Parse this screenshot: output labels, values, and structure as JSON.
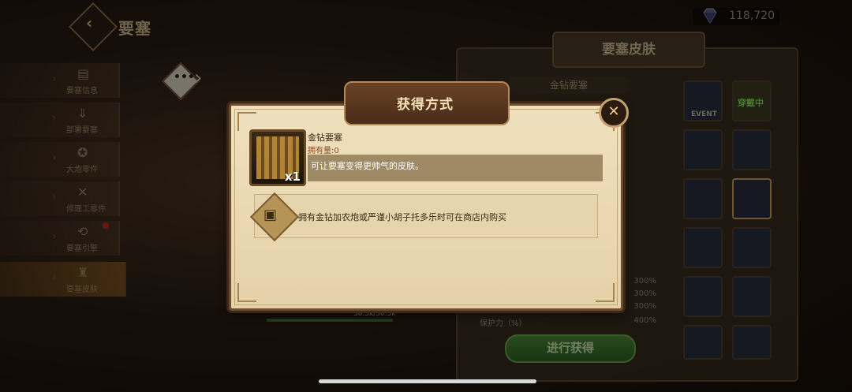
{
  "header": {
    "title": "要塞",
    "back_icon": "back-arrow-icon"
  },
  "currency": {
    "amount": "118,720",
    "icon": "gem-icon"
  },
  "sidebar": {
    "items": [
      {
        "label": "要塞信息",
        "icon": "book-icon"
      },
      {
        "label": "部署要塞",
        "icon": "deploy-icon"
      },
      {
        "label": "大炮零件",
        "icon": "cannon-part-icon"
      },
      {
        "label": "修理工零件",
        "icon": "repair-part-icon"
      },
      {
        "label": "要塞引擎",
        "icon": "engine-icon"
      },
      {
        "label": "要塞皮肤",
        "icon": "skin-icon"
      }
    ],
    "active_index": 5
  },
  "skin_panel": {
    "title": "要塞皮肤",
    "selected_name": "金钻要塞",
    "stats": [
      {
        "label": "",
        "value": "300%"
      },
      {
        "label": "",
        "value": "300%"
      },
      {
        "label": "",
        "value": "300%"
      },
      {
        "label": "保护力（%）",
        "value": "400%"
      }
    ],
    "acquire_button": "进行获得",
    "tiles": [
      {
        "label": "EVENT"
      },
      {
        "label": "穿戴中"
      }
    ]
  },
  "battle": {
    "hp_text": "30.5k/30.5k"
  },
  "modal": {
    "title": "获得方式",
    "close_icon": "close-icon",
    "item": {
      "name": "金钻要塞",
      "owned": "拥有量:0",
      "quantity": "x1",
      "description": "可让要塞变得更帅气的皮肤。"
    },
    "sources": [
      {
        "icon": "chest-icon",
        "text": "拥有金钻加农炮或严谨小胡子托多乐时可在商店内购买"
      }
    ]
  }
}
